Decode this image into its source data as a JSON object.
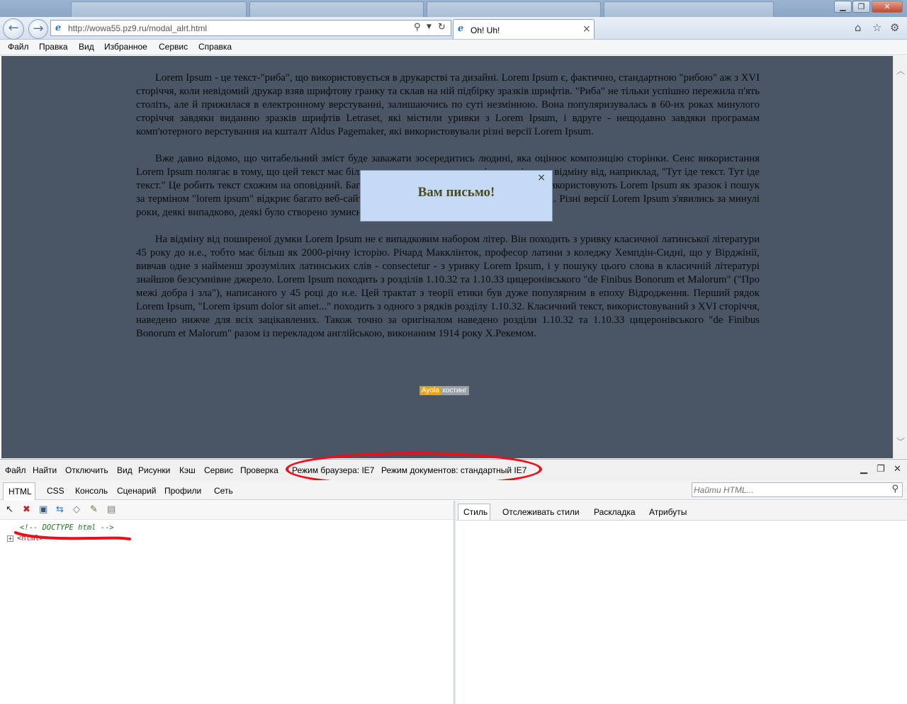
{
  "browser": {
    "address_url": "http://wowa55.pz9.ru/modal_alrt.html",
    "active_tab_title": "Oh! Uh!"
  },
  "menubar": {
    "items": [
      "Файл",
      "Правка",
      "Вид",
      "Избранное",
      "Сервис",
      "Справка"
    ]
  },
  "page": {
    "paragraphs": [
      "Lorem Ipsum - це текст-\"риба\", що використовується в друкарстві та дизайні. Lorem Ipsum є, фактично, стандартною \"рибою\" аж з XVI сторіччя, коли невідомий друкар взяв шрифтову гранку та склав на ній підбірку зразків шрифтів. \"Риба\" не тільки успішно пережила п'ять століть, але й прижилася в електронному верстуванні, залишаючись по суті незмінною. Вона популяризувалась в 60-их роках минулого сторіччя завдяки виданню зразків шрифтів Letraset, які містили уривки з Lorem Ipsum, і вдруге - нещодавно завдяки програмам комп'ютерного верстування на кшталт Aldus Pagemaker, які використовували різні версії Lorem Ipsum.",
      "Вже давно відомо, що читабельний зміст буде заважати зосередитись людині, яка оцінює композицію сторінки. Сенс використання Lorem Ipsum полягає в тому, що цей текст має більш-менш нормальне розподілення літер на відміну від, наприклад, \"Тут іде текст. Тут іде текст.\" Це робить текст схожим на оповідний. Багато програм верстування та веб-дизайну використовують Lorem Ipsum як зразок і пошук за терміном \"lorem ipsum\" відкриє багато веб-сайтів, які знаходяться ще в зародковому стані. Різні версії Lorem Ipsum з'явились за минулі роки, деякі випадково, деякі було створено зумисно (зокрема, жартівливі).",
      "На відміну від поширеної думки Lorem Ipsum не є випадковим набором літер. Він походить з уривку класичної латинської літератури 45 року до н.е., тобто має більш як 2000-річну історію. Річард Макклінток, професор латини з коледжу Хемпдін-Сидні, що у Вірджінії, вивчав одне з найменш зрозумілих латинських слів - consectetur - з уривку Lorem Ipsum, і у пошуку цього слова в класичній літературі знайшов безсумнівне джерело. Lorem Ipsum походить з розділів 1.10.32 та 1.10.33 цицеронівського \"de Finibus Bonorum et Malorum\" (\"Про межі добра і зла\"), написаного у 45 році до н.е. Цей трактат з теорії етики був дуже популярним в епоху Відродження. Перший рядок Lorem Ipsum, \"Lorem ipsum dolor sit amet...\" походить з одного з рядків розділу 1.10.32. Класичний текст, використовуваний з XVI сторіччя, наведено нижче для всіх зацікавлених. Також точно за оригіналом наведено розділи 1.10.32 та 1.10.33 цицеронівського \"de Finibus Bonorum et Malorum\" разом із перекладом англійською, виконаним 1914 року Х.Рекемом."
    ],
    "badge_left": "Ayola",
    "badge_right": "хостинг"
  },
  "modal": {
    "title": "Вам письмо!",
    "close_label": "×"
  },
  "devtools": {
    "menu": [
      "Файл",
      "Найти",
      "Отключить",
      "Вид",
      "Рисунки",
      "Кэш",
      "Сервис",
      "Проверка"
    ],
    "browser_mode": "Режим браузера:  IE7",
    "document_mode": "Режим документов: стандартный IE7",
    "tabs": [
      "HTML",
      "CSS",
      "Консоль",
      "Сценарий",
      "Профили",
      "Сеть"
    ],
    "search_placeholder": "Найти HTML...",
    "right_tabs": [
      "Стиль",
      "Отслеживать стили",
      "Раскладка",
      "Атрибуты"
    ],
    "tree": {
      "doctype": "<!-- DOCTYPE html -->",
      "html": "<html>",
      "expander": "+"
    }
  },
  "colors": {
    "viewport_bg": "#4a5565",
    "modal_bg": "#c5daf4",
    "annotation_red": "#e8101a",
    "badge_orange": "#e8a318"
  }
}
